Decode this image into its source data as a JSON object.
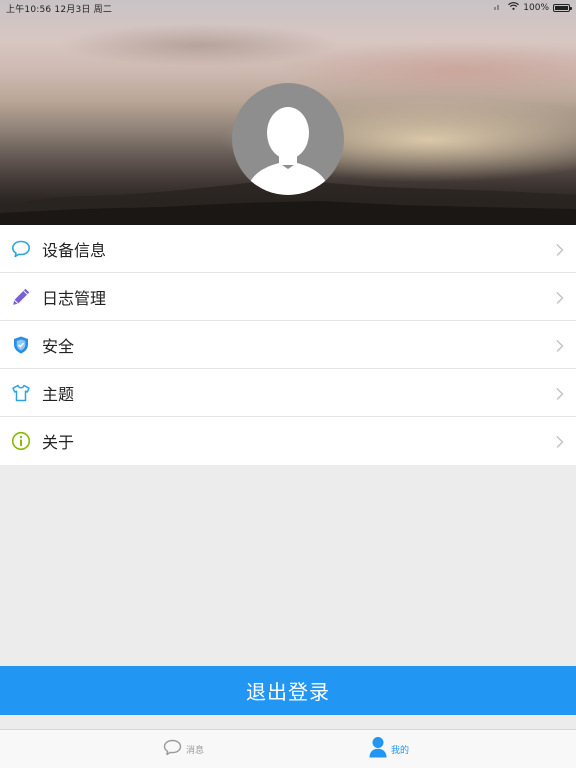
{
  "status_bar": {
    "time_date": "上午10:56  12月3日 周二",
    "battery_percent": "100%",
    "battery_level": 1.0
  },
  "profile": {
    "avatar_icon": "default-user-avatar-icon"
  },
  "menu": {
    "items": [
      {
        "label": "设备信息",
        "icon": "chat-bubble-icon",
        "color": "#29a8e0"
      },
      {
        "label": "日志管理",
        "icon": "pencil-icon",
        "color": "#7a5fd3"
      },
      {
        "label": "安全",
        "icon": "shield-icon",
        "color": "#2b8fe6"
      },
      {
        "label": "主题",
        "icon": "tshirt-icon",
        "color": "#2ba4e6"
      },
      {
        "label": "关于",
        "icon": "info-icon",
        "color": "#8cb800"
      }
    ],
    "chevron_icon": "chevron-right-icon"
  },
  "logout": {
    "label": "退出登录",
    "color": "#2196f3"
  },
  "tabbar": {
    "tabs": [
      {
        "label": "消息",
        "icon": "chat-bubble-icon",
        "active": false
      },
      {
        "label": "我的",
        "icon": "person-icon",
        "active": true
      }
    ],
    "active_color": "#2196f3",
    "inactive_color": "#9a9a9a"
  }
}
